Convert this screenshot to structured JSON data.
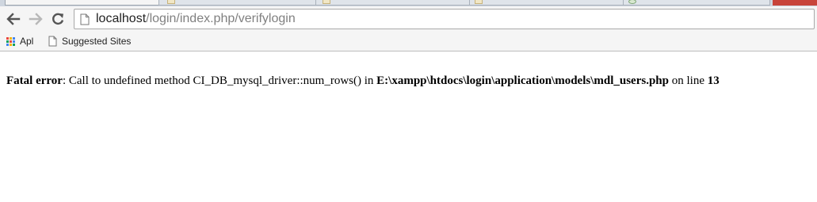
{
  "browser": {
    "address_bar": {
      "url_host": "localhost",
      "url_path": "/login/index.php/verifylogin"
    },
    "bookmarks": {
      "apps_label": "Apl",
      "suggested_label": "Suggested Sites"
    },
    "icons": {
      "back": "back-arrow-icon",
      "forward": "forward-arrow-icon",
      "reload": "reload-icon",
      "page": "page-icon",
      "apps": "apps-grid-icon"
    },
    "colors": {
      "tabstrip": "#cfd6df",
      "toolbar": "#f5f5f5",
      "window_close": "#c8443a"
    }
  },
  "page": {
    "error": {
      "label": "Fatal error",
      "separator": ": ",
      "message": "Call to undefined method CI_DB_mysql_driver::num_rows() in ",
      "file": "E:\\xampp\\htdocs\\login\\application\\models\\mdl_users.php",
      "line_text": " on line ",
      "line_number": "13"
    }
  }
}
